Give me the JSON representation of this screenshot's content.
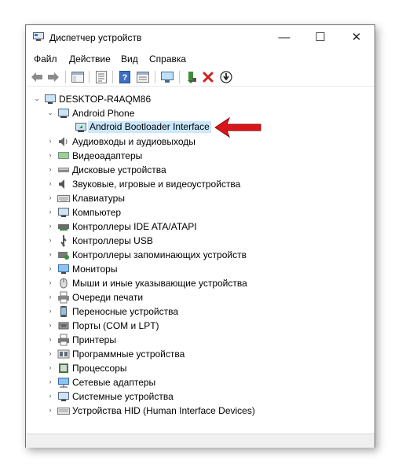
{
  "window": {
    "title": "Диспетчер устройств"
  },
  "window_controls": {
    "minimize": "—",
    "maximize": "☐",
    "close": "✕"
  },
  "menu": [
    "Файл",
    "Действие",
    "Вид",
    "Справка"
  ],
  "toolbar": [
    "back-icon",
    "forward-icon",
    "console-tree-icon",
    "properties-icon",
    "help-icon",
    "view-icon",
    "monitor-scan-icon",
    "update-driver-icon",
    "uninstall-icon",
    "download-driver-icon"
  ],
  "tree": {
    "root": "DESKTOP-R4AQM86",
    "expanded_group": "Android Phone",
    "selected_device": "Android Bootloader Interface",
    "categories": [
      "Аудиовходы и аудиовыходы",
      "Видеоадаптеры",
      "Дисковые устройства",
      "Звуковые, игровые и видеоустройства",
      "Клавиатуры",
      "Компьютер",
      "Контроллеры IDE ATA/ATAPI",
      "Контроллеры USB",
      "Контроллеры запоминающих устройств",
      "Мониторы",
      "Мыши и иные указывающие устройства",
      "Очереди печати",
      "Переносные устройства",
      "Порты (COM и LPT)",
      "Принтеры",
      "Программные устройства",
      "Процессоры",
      "Сетевые адаптеры",
      "Системные устройства",
      "Устройства HID (Human Interface Devices)"
    ]
  },
  "colors": {
    "selection": "#cce8ff",
    "arrow": "#d9151b"
  }
}
